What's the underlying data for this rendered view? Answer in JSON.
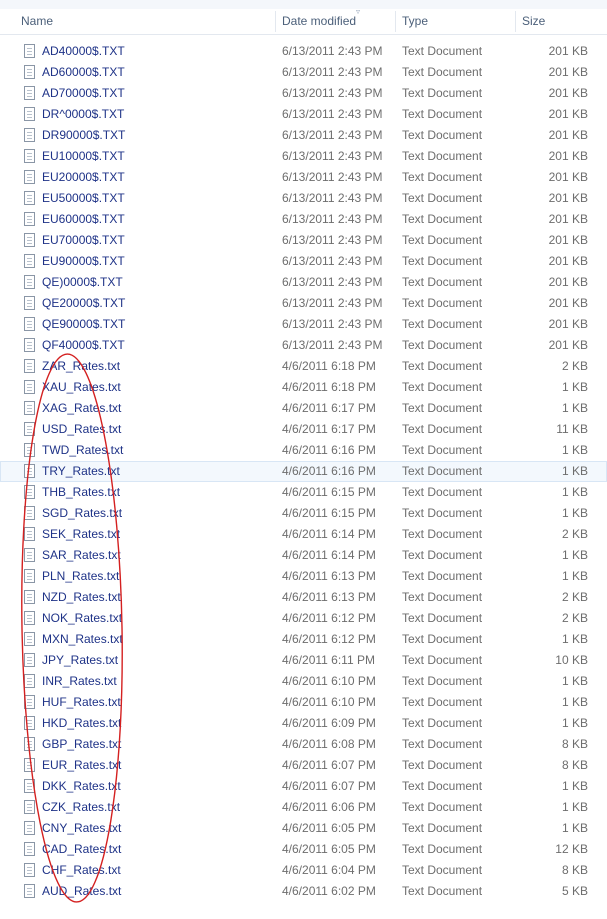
{
  "columns": {
    "name": "Name",
    "date_modified": "Date modified",
    "type": "Type",
    "size": "Size"
  },
  "files": [
    {
      "name": "AD40000$.TXT",
      "date": "6/13/2011 2:43 PM",
      "type": "Text Document",
      "size": "201 KB"
    },
    {
      "name": "AD60000$.TXT",
      "date": "6/13/2011 2:43 PM",
      "type": "Text Document",
      "size": "201 KB"
    },
    {
      "name": "AD70000$.TXT",
      "date": "6/13/2011 2:43 PM",
      "type": "Text Document",
      "size": "201 KB"
    },
    {
      "name": "DR^0000$.TXT",
      "date": "6/13/2011 2:43 PM",
      "type": "Text Document",
      "size": "201 KB"
    },
    {
      "name": "DR90000$.TXT",
      "date": "6/13/2011 2:43 PM",
      "type": "Text Document",
      "size": "201 KB"
    },
    {
      "name": "EU10000$.TXT",
      "date": "6/13/2011 2:43 PM",
      "type": "Text Document",
      "size": "201 KB"
    },
    {
      "name": "EU20000$.TXT",
      "date": "6/13/2011 2:43 PM",
      "type": "Text Document",
      "size": "201 KB"
    },
    {
      "name": "EU50000$.TXT",
      "date": "6/13/2011 2:43 PM",
      "type": "Text Document",
      "size": "201 KB"
    },
    {
      "name": "EU60000$.TXT",
      "date": "6/13/2011 2:43 PM",
      "type": "Text Document",
      "size": "201 KB"
    },
    {
      "name": "EU70000$.TXT",
      "date": "6/13/2011 2:43 PM",
      "type": "Text Document",
      "size": "201 KB"
    },
    {
      "name": "EU90000$.TXT",
      "date": "6/13/2011 2:43 PM",
      "type": "Text Document",
      "size": "201 KB"
    },
    {
      "name": "QE)0000$.TXT",
      "date": "6/13/2011 2:43 PM",
      "type": "Text Document",
      "size": "201 KB"
    },
    {
      "name": "QE20000$.TXT",
      "date": "6/13/2011 2:43 PM",
      "type": "Text Document",
      "size": "201 KB"
    },
    {
      "name": "QE90000$.TXT",
      "date": "6/13/2011 2:43 PM",
      "type": "Text Document",
      "size": "201 KB"
    },
    {
      "name": "QF40000$.TXT",
      "date": "6/13/2011 2:43 PM",
      "type": "Text Document",
      "size": "201 KB"
    },
    {
      "name": "ZAR_Rates.txt",
      "date": "4/6/2011 6:18 PM",
      "type": "Text Document",
      "size": "2 KB"
    },
    {
      "name": "XAU_Rates.txt",
      "date": "4/6/2011 6:18 PM",
      "type": "Text Document",
      "size": "1 KB"
    },
    {
      "name": "XAG_Rates.txt",
      "date": "4/6/2011 6:17 PM",
      "type": "Text Document",
      "size": "1 KB"
    },
    {
      "name": "USD_Rates.txt",
      "date": "4/6/2011 6:17 PM",
      "type": "Text Document",
      "size": "11 KB"
    },
    {
      "name": "TWD_Rates.txt",
      "date": "4/6/2011 6:16 PM",
      "type": "Text Document",
      "size": "1 KB"
    },
    {
      "name": "TRY_Rates.txt",
      "date": "4/6/2011 6:16 PM",
      "type": "Text Document",
      "size": "1 KB",
      "selected": true
    },
    {
      "name": "THB_Rates.txt",
      "date": "4/6/2011 6:15 PM",
      "type": "Text Document",
      "size": "1 KB"
    },
    {
      "name": "SGD_Rates.txt",
      "date": "4/6/2011 6:15 PM",
      "type": "Text Document",
      "size": "1 KB"
    },
    {
      "name": "SEK_Rates.txt",
      "date": "4/6/2011 6:14 PM",
      "type": "Text Document",
      "size": "2 KB"
    },
    {
      "name": "SAR_Rates.txt",
      "date": "4/6/2011 6:14 PM",
      "type": "Text Document",
      "size": "1 KB"
    },
    {
      "name": "PLN_Rates.txt",
      "date": "4/6/2011 6:13 PM",
      "type": "Text Document",
      "size": "1 KB"
    },
    {
      "name": "NZD_Rates.txt",
      "date": "4/6/2011 6:13 PM",
      "type": "Text Document",
      "size": "2 KB"
    },
    {
      "name": "NOK_Rates.txt",
      "date": "4/6/2011 6:12 PM",
      "type": "Text Document",
      "size": "2 KB"
    },
    {
      "name": "MXN_Rates.txt",
      "date": "4/6/2011 6:12 PM",
      "type": "Text Document",
      "size": "1 KB"
    },
    {
      "name": "JPY_Rates.txt",
      "date": "4/6/2011 6:11 PM",
      "type": "Text Document",
      "size": "10 KB"
    },
    {
      "name": "INR_Rates.txt",
      "date": "4/6/2011 6:10 PM",
      "type": "Text Document",
      "size": "1 KB"
    },
    {
      "name": "HUF_Rates.txt",
      "date": "4/6/2011 6:10 PM",
      "type": "Text Document",
      "size": "1 KB"
    },
    {
      "name": "HKD_Rates.txt",
      "date": "4/6/2011 6:09 PM",
      "type": "Text Document",
      "size": "1 KB"
    },
    {
      "name": "GBP_Rates.txt",
      "date": "4/6/2011 6:08 PM",
      "type": "Text Document",
      "size": "8 KB"
    },
    {
      "name": "EUR_Rates.txt",
      "date": "4/6/2011 6:07 PM",
      "type": "Text Document",
      "size": "8 KB"
    },
    {
      "name": "DKK_Rates.txt",
      "date": "4/6/2011 6:07 PM",
      "type": "Text Document",
      "size": "1 KB"
    },
    {
      "name": "CZK_Rates.txt",
      "date": "4/6/2011 6:06 PM",
      "type": "Text Document",
      "size": "1 KB"
    },
    {
      "name": "CNY_Rates.txt",
      "date": "4/6/2011 6:05 PM",
      "type": "Text Document",
      "size": "1 KB"
    },
    {
      "name": "CAD_Rates.txt",
      "date": "4/6/2011 6:05 PM",
      "type": "Text Document",
      "size": "12 KB"
    },
    {
      "name": "CHF_Rates.txt",
      "date": "4/6/2011 6:04 PM",
      "type": "Text Document",
      "size": "8 KB"
    },
    {
      "name": "AUD_Rates.txt",
      "date": "4/6/2011 6:02 PM",
      "type": "Text Document",
      "size": "5 KB"
    }
  ],
  "icons": {
    "file": "text-document-icon",
    "sort": "sort-indicator-icon"
  },
  "colors": {
    "name_text": "#1e3287",
    "detail_text": "#6d6d6d",
    "header_text": "#4c607a",
    "selection_fill": "#f3f8fd",
    "selection_border": "#d8e6f5",
    "annotation_ellipse": "#d42020"
  }
}
